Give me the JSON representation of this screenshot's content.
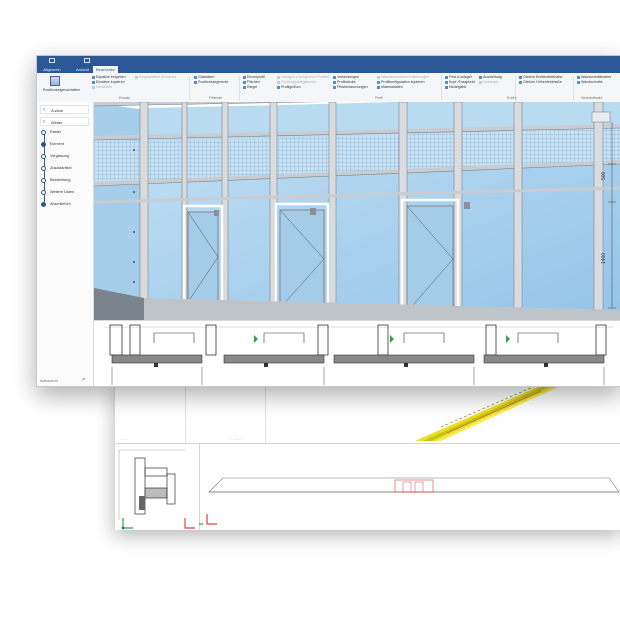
{
  "app": {
    "titlebar_icons": [
      "undo-icon",
      "save-icon"
    ]
  },
  "tabs": [
    {
      "label": "Allgemein",
      "active": false
    },
    {
      "label": "Ansicht",
      "active": false
    },
    {
      "label": "Bearbeiten",
      "active": true
    }
  ],
  "ribbon": {
    "big_button_label": "Positionseigenschaften",
    "groups": [
      "Einsatz",
      "Füllende",
      "Profil",
      "Rollen",
      "Werkstoffwahl"
    ],
    "items": [
      {
        "label": "Equalize eingeben",
        "enabled": true
      },
      {
        "label": "Einsätze kopieren",
        "enabled": true
      },
      {
        "label": "Ringelplatten (Konsole)",
        "enabled": false
      },
      {
        "label": "Versetzen",
        "enabled": false
      },
      {
        "label": "Glasdaten",
        "enabled": true
      },
      {
        "label": "Positionssegmente",
        "enabled": true
      },
      {
        "label": "Einzelprofil",
        "enabled": true
      },
      {
        "label": "Flächen",
        "enabled": true
      },
      {
        "label": "Riegel",
        "enabled": true
      },
      {
        "label": "Profilgrößen",
        "enabled": true
      },
      {
        "label": "Vorlagen (Gelegenheit Profile)",
        "enabled": false
      },
      {
        "label": "Gehrungsausgleichen",
        "enabled": false
      },
      {
        "label": "Verbindungen",
        "enabled": true
      },
      {
        "label": "Profilstücke",
        "enabled": true
      },
      {
        "label": "Pfostenlaschungen",
        "enabled": true
      },
      {
        "label": "Wandanschluss-Einstellungen",
        "enabled": false
      },
      {
        "label": "Profilkonfiguration kopieren",
        "enabled": true
      },
      {
        "label": "Materialdaten",
        "enabled": true
      },
      {
        "label": "Fest-/Loslager",
        "enabled": true
      },
      {
        "label": "Kopf-/Fusspunkt",
        "enabled": true
      },
      {
        "label": "Neuingabe",
        "enabled": true
      },
      {
        "label": "Aussteifung",
        "enabled": true
      },
      {
        "label": "Verbinder",
        "enabled": false
      },
      {
        "label": "Gleiche Breitenfeldmaße",
        "enabled": true
      },
      {
        "label": "Gleiche Höhenfeldmaße",
        "enabled": true
      },
      {
        "label": "Wandschnittkosten",
        "enabled": true
      },
      {
        "label": "Wandschnitte",
        "enabled": true
      }
    ]
  },
  "sidebar": {
    "back_label": "Zurück",
    "forward_label": "Weiter",
    "steps": [
      {
        "label": "Raster",
        "done": false
      },
      {
        "label": "Element",
        "done": true
      },
      {
        "label": "Verglasung",
        "done": false
      },
      {
        "label": "Zusatzartikel",
        "done": false
      },
      {
        "label": "Bearbeitung",
        "done": false
      },
      {
        "label": "Weitere Daten",
        "done": false
      },
      {
        "label": "Abschließen",
        "done": true
      }
    ],
    "footer_label": "Aufbausicht"
  },
  "drawing": {
    "dim_upper": "500",
    "dim_lower": "1400"
  },
  "colors": {
    "titlebar": "#2b5797",
    "glass": "#a8d0ee",
    "grid_glass": "#c8e2f5",
    "frame": "#d8dcdf",
    "beam_yellow": "#e8e020",
    "accent_red": "#e04040",
    "accent_green": "#30a040"
  }
}
